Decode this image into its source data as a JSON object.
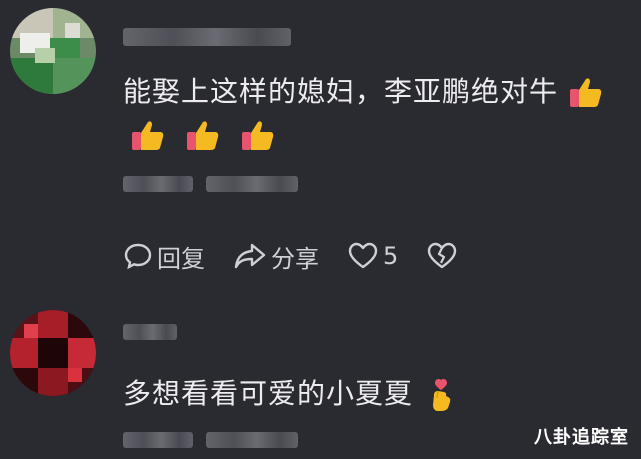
{
  "comments": [
    {
      "text": "能娶上这样的媳妇，李亚鹏绝对牛",
      "emoji_name": "thumbs-up",
      "actions": {
        "reply_label": "回复",
        "share_label": "分享",
        "like_count": "5"
      }
    },
    {
      "text": "多想看看可爱的小夏夏",
      "emoji_name": "finger-heart"
    }
  ],
  "watermark": "八卦追踪室",
  "colors": {
    "background": "#2a2a31",
    "thumb": "#f5b921",
    "thumb_cuff": "#e8546d"
  }
}
